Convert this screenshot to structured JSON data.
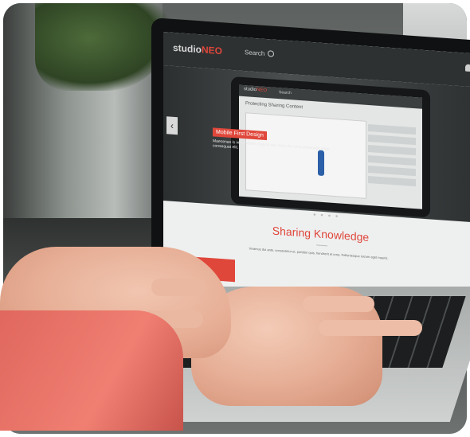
{
  "screen": {
    "logo": {
      "prefix": "studio",
      "accent": "NEO"
    },
    "search_label": "Search",
    "hero_badge": "Mobile First Design",
    "hero_subtitle": "Maecenas is in hendrerit magna vel, Nam dui urna venenatis vitae consequat elit.",
    "tablet": {
      "logo_prefix": "studio",
      "logo_accent": "NEO",
      "search_label": "Search",
      "title": "Protecting Sharing Content"
    },
    "section_title": "Sharing Knowledge",
    "section_subtitle": "Vivamus dui ante, consectetur et, porttitor quis, hendrerit et urna. Pellentesque rutrum eget mauris."
  },
  "colors": {
    "accent": "#e0473b"
  }
}
